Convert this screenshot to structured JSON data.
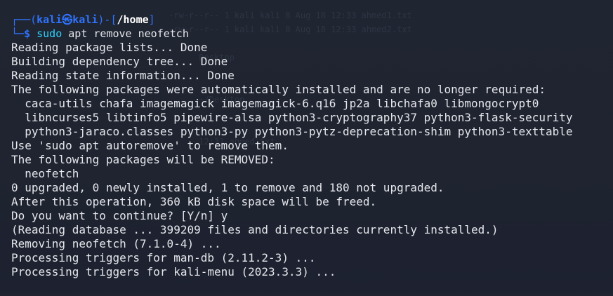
{
  "prompt": {
    "user": "kali",
    "symbol": "㉿",
    "host": "kali",
    "path": "/home",
    "dollar": "$",
    "command_sudo": "sudo",
    "command_rest": " apt remove neofetch"
  },
  "output": [
    "Reading package lists... Done",
    "Building dependency tree... Done",
    "Reading state information... Done",
    "The following packages were automatically installed and are no longer required:",
    "  caca-utils chafa imagemagick imagemagick-6.q16 jp2a libchafa0 libmongocrypt0",
    "  libncurses5 libtinfo5 pipewire-alsa python3-cryptography37 python3-flask-security",
    "  python3-jaraco.classes python3-py python3-pytz-deprecation-shim python3-texttable",
    "Use 'sudo apt autoremove' to remove them.",
    "The following packages will be REMOVED:",
    "  neofetch",
    "0 upgraded, 0 newly installed, 1 to remove and 180 not upgraded.",
    "After this operation, 360 kB disk space will be freed.",
    "Do you want to continue? [Y/n] y",
    "(Reading database ... 399209 files and directories currently installed.)",
    "Removing neofetch (7.1.0-4) ...",
    "Processing triggers for man-db (2.11.2-3) ...",
    "Processing triggers for kali-menu (2023.3.3) ..."
  ],
  "colors": {
    "background": "#1f2430",
    "prompt_blue": "#2f74ff",
    "command_cyan": "#2dd4ff",
    "text": "#e5e7eb"
  }
}
